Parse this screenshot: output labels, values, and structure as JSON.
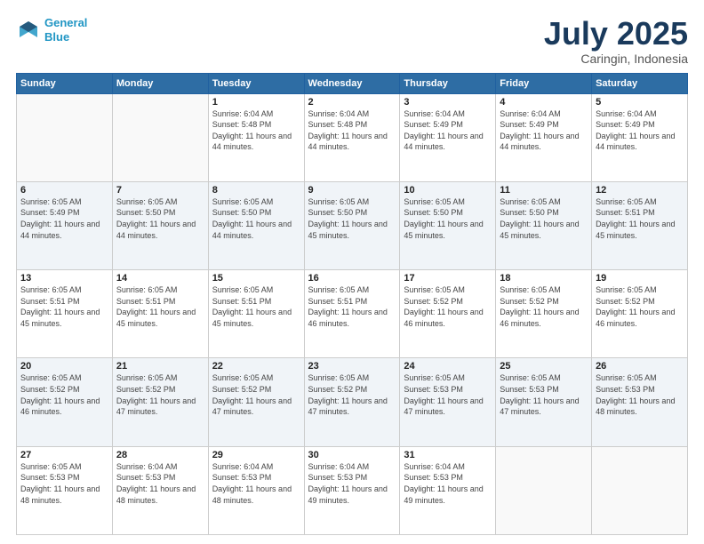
{
  "header": {
    "logo_line1": "General",
    "logo_line2": "Blue",
    "month": "July 2025",
    "location": "Caringin, Indonesia"
  },
  "weekdays": [
    "Sunday",
    "Monday",
    "Tuesday",
    "Wednesday",
    "Thursday",
    "Friday",
    "Saturday"
  ],
  "weeks": [
    [
      {
        "day": "",
        "info": ""
      },
      {
        "day": "",
        "info": ""
      },
      {
        "day": "1",
        "info": "Sunrise: 6:04 AM\nSunset: 5:48 PM\nDaylight: 11 hours and 44 minutes."
      },
      {
        "day": "2",
        "info": "Sunrise: 6:04 AM\nSunset: 5:48 PM\nDaylight: 11 hours and 44 minutes."
      },
      {
        "day": "3",
        "info": "Sunrise: 6:04 AM\nSunset: 5:49 PM\nDaylight: 11 hours and 44 minutes."
      },
      {
        "day": "4",
        "info": "Sunrise: 6:04 AM\nSunset: 5:49 PM\nDaylight: 11 hours and 44 minutes."
      },
      {
        "day": "5",
        "info": "Sunrise: 6:04 AM\nSunset: 5:49 PM\nDaylight: 11 hours and 44 minutes."
      }
    ],
    [
      {
        "day": "6",
        "info": "Sunrise: 6:05 AM\nSunset: 5:49 PM\nDaylight: 11 hours and 44 minutes."
      },
      {
        "day": "7",
        "info": "Sunrise: 6:05 AM\nSunset: 5:50 PM\nDaylight: 11 hours and 44 minutes."
      },
      {
        "day": "8",
        "info": "Sunrise: 6:05 AM\nSunset: 5:50 PM\nDaylight: 11 hours and 44 minutes."
      },
      {
        "day": "9",
        "info": "Sunrise: 6:05 AM\nSunset: 5:50 PM\nDaylight: 11 hours and 45 minutes."
      },
      {
        "day": "10",
        "info": "Sunrise: 6:05 AM\nSunset: 5:50 PM\nDaylight: 11 hours and 45 minutes."
      },
      {
        "day": "11",
        "info": "Sunrise: 6:05 AM\nSunset: 5:50 PM\nDaylight: 11 hours and 45 minutes."
      },
      {
        "day": "12",
        "info": "Sunrise: 6:05 AM\nSunset: 5:51 PM\nDaylight: 11 hours and 45 minutes."
      }
    ],
    [
      {
        "day": "13",
        "info": "Sunrise: 6:05 AM\nSunset: 5:51 PM\nDaylight: 11 hours and 45 minutes."
      },
      {
        "day": "14",
        "info": "Sunrise: 6:05 AM\nSunset: 5:51 PM\nDaylight: 11 hours and 45 minutes."
      },
      {
        "day": "15",
        "info": "Sunrise: 6:05 AM\nSunset: 5:51 PM\nDaylight: 11 hours and 45 minutes."
      },
      {
        "day": "16",
        "info": "Sunrise: 6:05 AM\nSunset: 5:51 PM\nDaylight: 11 hours and 46 minutes."
      },
      {
        "day": "17",
        "info": "Sunrise: 6:05 AM\nSunset: 5:52 PM\nDaylight: 11 hours and 46 minutes."
      },
      {
        "day": "18",
        "info": "Sunrise: 6:05 AM\nSunset: 5:52 PM\nDaylight: 11 hours and 46 minutes."
      },
      {
        "day": "19",
        "info": "Sunrise: 6:05 AM\nSunset: 5:52 PM\nDaylight: 11 hours and 46 minutes."
      }
    ],
    [
      {
        "day": "20",
        "info": "Sunrise: 6:05 AM\nSunset: 5:52 PM\nDaylight: 11 hours and 46 minutes."
      },
      {
        "day": "21",
        "info": "Sunrise: 6:05 AM\nSunset: 5:52 PM\nDaylight: 11 hours and 47 minutes."
      },
      {
        "day": "22",
        "info": "Sunrise: 6:05 AM\nSunset: 5:52 PM\nDaylight: 11 hours and 47 minutes."
      },
      {
        "day": "23",
        "info": "Sunrise: 6:05 AM\nSunset: 5:52 PM\nDaylight: 11 hours and 47 minutes."
      },
      {
        "day": "24",
        "info": "Sunrise: 6:05 AM\nSunset: 5:53 PM\nDaylight: 11 hours and 47 minutes."
      },
      {
        "day": "25",
        "info": "Sunrise: 6:05 AM\nSunset: 5:53 PM\nDaylight: 11 hours and 47 minutes."
      },
      {
        "day": "26",
        "info": "Sunrise: 6:05 AM\nSunset: 5:53 PM\nDaylight: 11 hours and 48 minutes."
      }
    ],
    [
      {
        "day": "27",
        "info": "Sunrise: 6:05 AM\nSunset: 5:53 PM\nDaylight: 11 hours and 48 minutes."
      },
      {
        "day": "28",
        "info": "Sunrise: 6:04 AM\nSunset: 5:53 PM\nDaylight: 11 hours and 48 minutes."
      },
      {
        "day": "29",
        "info": "Sunrise: 6:04 AM\nSunset: 5:53 PM\nDaylight: 11 hours and 48 minutes."
      },
      {
        "day": "30",
        "info": "Sunrise: 6:04 AM\nSunset: 5:53 PM\nDaylight: 11 hours and 49 minutes."
      },
      {
        "day": "31",
        "info": "Sunrise: 6:04 AM\nSunset: 5:53 PM\nDaylight: 11 hours and 49 minutes."
      },
      {
        "day": "",
        "info": ""
      },
      {
        "day": "",
        "info": ""
      }
    ]
  ]
}
